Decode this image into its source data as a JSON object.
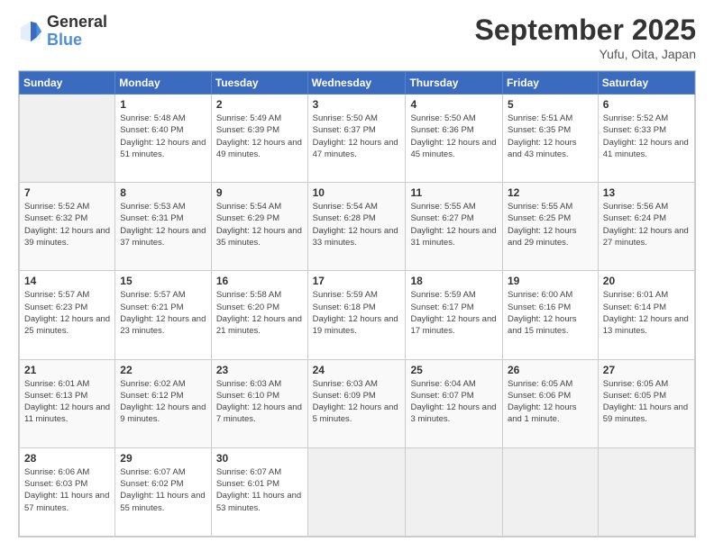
{
  "logo": {
    "general": "General",
    "blue": "Blue"
  },
  "header": {
    "month": "September 2025",
    "location": "Yufu, Oita, Japan"
  },
  "weekdays": [
    "Sunday",
    "Monday",
    "Tuesday",
    "Wednesday",
    "Thursday",
    "Friday",
    "Saturday"
  ],
  "weeks": [
    [
      {
        "day": "",
        "info": ""
      },
      {
        "day": "1",
        "info": "Sunrise: 5:48 AM\nSunset: 6:40 PM\nDaylight: 12 hours\nand 51 minutes."
      },
      {
        "day": "2",
        "info": "Sunrise: 5:49 AM\nSunset: 6:39 PM\nDaylight: 12 hours\nand 49 minutes."
      },
      {
        "day": "3",
        "info": "Sunrise: 5:50 AM\nSunset: 6:37 PM\nDaylight: 12 hours\nand 47 minutes."
      },
      {
        "day": "4",
        "info": "Sunrise: 5:50 AM\nSunset: 6:36 PM\nDaylight: 12 hours\nand 45 minutes."
      },
      {
        "day": "5",
        "info": "Sunrise: 5:51 AM\nSunset: 6:35 PM\nDaylight: 12 hours\nand 43 minutes."
      },
      {
        "day": "6",
        "info": "Sunrise: 5:52 AM\nSunset: 6:33 PM\nDaylight: 12 hours\nand 41 minutes."
      }
    ],
    [
      {
        "day": "7",
        "info": "Sunrise: 5:52 AM\nSunset: 6:32 PM\nDaylight: 12 hours\nand 39 minutes."
      },
      {
        "day": "8",
        "info": "Sunrise: 5:53 AM\nSunset: 6:31 PM\nDaylight: 12 hours\nand 37 minutes."
      },
      {
        "day": "9",
        "info": "Sunrise: 5:54 AM\nSunset: 6:29 PM\nDaylight: 12 hours\nand 35 minutes."
      },
      {
        "day": "10",
        "info": "Sunrise: 5:54 AM\nSunset: 6:28 PM\nDaylight: 12 hours\nand 33 minutes."
      },
      {
        "day": "11",
        "info": "Sunrise: 5:55 AM\nSunset: 6:27 PM\nDaylight: 12 hours\nand 31 minutes."
      },
      {
        "day": "12",
        "info": "Sunrise: 5:55 AM\nSunset: 6:25 PM\nDaylight: 12 hours\nand 29 minutes."
      },
      {
        "day": "13",
        "info": "Sunrise: 5:56 AM\nSunset: 6:24 PM\nDaylight: 12 hours\nand 27 minutes."
      }
    ],
    [
      {
        "day": "14",
        "info": "Sunrise: 5:57 AM\nSunset: 6:23 PM\nDaylight: 12 hours\nand 25 minutes."
      },
      {
        "day": "15",
        "info": "Sunrise: 5:57 AM\nSunset: 6:21 PM\nDaylight: 12 hours\nand 23 minutes."
      },
      {
        "day": "16",
        "info": "Sunrise: 5:58 AM\nSunset: 6:20 PM\nDaylight: 12 hours\nand 21 minutes."
      },
      {
        "day": "17",
        "info": "Sunrise: 5:59 AM\nSunset: 6:18 PM\nDaylight: 12 hours\nand 19 minutes."
      },
      {
        "day": "18",
        "info": "Sunrise: 5:59 AM\nSunset: 6:17 PM\nDaylight: 12 hours\nand 17 minutes."
      },
      {
        "day": "19",
        "info": "Sunrise: 6:00 AM\nSunset: 6:16 PM\nDaylight: 12 hours\nand 15 minutes."
      },
      {
        "day": "20",
        "info": "Sunrise: 6:01 AM\nSunset: 6:14 PM\nDaylight: 12 hours\nand 13 minutes."
      }
    ],
    [
      {
        "day": "21",
        "info": "Sunrise: 6:01 AM\nSunset: 6:13 PM\nDaylight: 12 hours\nand 11 minutes."
      },
      {
        "day": "22",
        "info": "Sunrise: 6:02 AM\nSunset: 6:12 PM\nDaylight: 12 hours\nand 9 minutes."
      },
      {
        "day": "23",
        "info": "Sunrise: 6:03 AM\nSunset: 6:10 PM\nDaylight: 12 hours\nand 7 minutes."
      },
      {
        "day": "24",
        "info": "Sunrise: 6:03 AM\nSunset: 6:09 PM\nDaylight: 12 hours\nand 5 minutes."
      },
      {
        "day": "25",
        "info": "Sunrise: 6:04 AM\nSunset: 6:07 PM\nDaylight: 12 hours\nand 3 minutes."
      },
      {
        "day": "26",
        "info": "Sunrise: 6:05 AM\nSunset: 6:06 PM\nDaylight: 12 hours\nand 1 minute."
      },
      {
        "day": "27",
        "info": "Sunrise: 6:05 AM\nSunset: 6:05 PM\nDaylight: 11 hours\nand 59 minutes."
      }
    ],
    [
      {
        "day": "28",
        "info": "Sunrise: 6:06 AM\nSunset: 6:03 PM\nDaylight: 11 hours\nand 57 minutes."
      },
      {
        "day": "29",
        "info": "Sunrise: 6:07 AM\nSunset: 6:02 PM\nDaylight: 11 hours\nand 55 minutes."
      },
      {
        "day": "30",
        "info": "Sunrise: 6:07 AM\nSunset: 6:01 PM\nDaylight: 11 hours\nand 53 minutes."
      },
      {
        "day": "",
        "info": ""
      },
      {
        "day": "",
        "info": ""
      },
      {
        "day": "",
        "info": ""
      },
      {
        "day": "",
        "info": ""
      }
    ]
  ]
}
